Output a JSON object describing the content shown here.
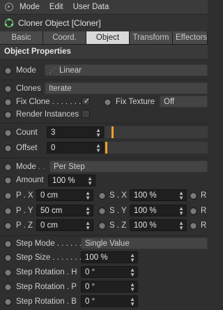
{
  "menubar": {
    "items": [
      "Mode",
      "Edit",
      "User Data"
    ]
  },
  "object": {
    "title": "Cloner Object [Cloner]"
  },
  "tabs": [
    "Basic",
    "Coord.",
    "Object",
    "Transform",
    "Effectors"
  ],
  "active_tab": "Object",
  "section": {
    "title": "Object Properties"
  },
  "mode": {
    "label": "Mode",
    "value": "Linear"
  },
  "clones": {
    "label": "Clones",
    "value": "Iterate"
  },
  "fix_clone": {
    "label": "Fix Clone . . . . . . . .",
    "checked": true
  },
  "fix_texture": {
    "label": "Fix Texture",
    "value": "Off"
  },
  "render_instances": {
    "label": "Render Instances",
    "checked": false
  },
  "count": {
    "label": "Count",
    "value": "3",
    "slider_fraction": 0.06
  },
  "offset": {
    "label": "Offset",
    "value": "0",
    "slider_fraction": 0.0
  },
  "mode2": {
    "label": "Mode",
    "value": "Per Step"
  },
  "amount": {
    "label": "Amount",
    "value": "100 %"
  },
  "p": [
    {
      "label": "P . X",
      "value": "0 cm"
    },
    {
      "label": "P . Y",
      "value": "50 cm"
    },
    {
      "label": "P . Z",
      "value": "0 cm"
    }
  ],
  "s": [
    {
      "label": "S . X",
      "value": "100 %"
    },
    {
      "label": "S . Y",
      "value": "100 %"
    },
    {
      "label": "S . Z",
      "value": "100 %"
    }
  ],
  "r_label": "R",
  "step_mode": {
    "label": "Step Mode . . . . . . . .",
    "value": "Single Value"
  },
  "step_size": {
    "label": "Step Size . . . . . . .",
    "value": "100 %"
  },
  "step_rot": [
    {
      "label": "Step Rotation . H",
      "value": "0 °"
    },
    {
      "label": "Step Rotation . P",
      "value": "0 °"
    },
    {
      "label": "Step Rotation . B",
      "value": "0 °"
    }
  ],
  "colors": {
    "accent": "#f0a02a",
    "tab_active": "#d9d9d9",
    "field_bg": "#1f1f1f"
  }
}
